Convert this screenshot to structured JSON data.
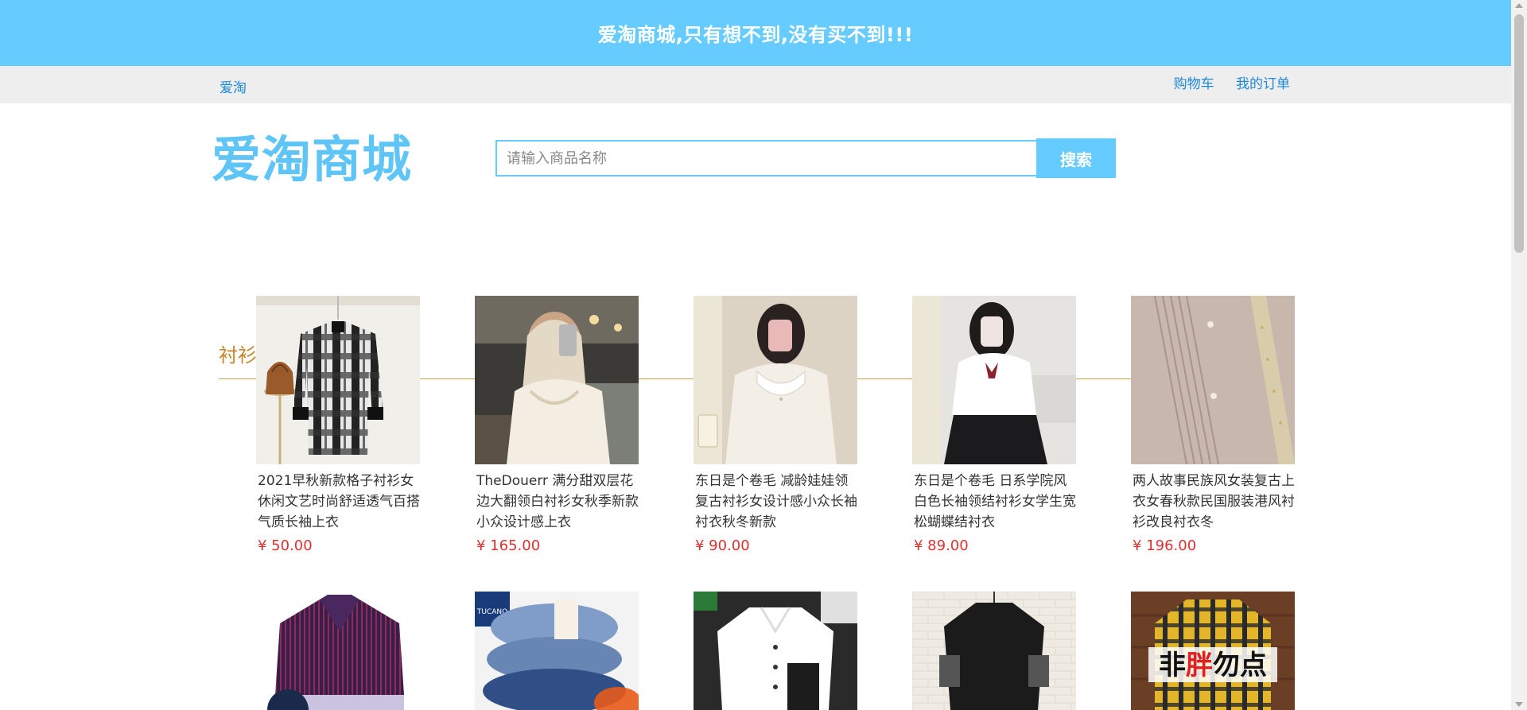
{
  "banner": {
    "text": "爱淘商城,只有想不到,没有买不到!!!"
  },
  "topnav": {
    "brand": "爱淘",
    "cart": "购物车",
    "orders": "我的订单"
  },
  "header": {
    "logo": "爱淘商城",
    "search_placeholder": "请输入商品名称",
    "search_button": "搜索"
  },
  "category": {
    "title": "衬衫"
  },
  "products": [
    {
      "title": "2021早秋新款格子衬衫女休闲文艺时尚舒适透气百搭气质长袖上衣",
      "price": "¥ 50.00"
    },
    {
      "title": "TheDouerr 满分甜双层花边大翻领白衬衫女秋季新款小众设计感上衣",
      "price": "¥ 165.00"
    },
    {
      "title": "东日是个卷毛 减龄娃娃领复古衬衫女设计感小众长袖衬衣秋冬新款",
      "price": "¥ 90.00"
    },
    {
      "title": "东日是个卷毛 日系学院风白色长袖领结衬衫女学生宽松蝴蝶结衬衣",
      "price": "¥ 89.00"
    },
    {
      "title": "两人故事民族风女装复古上衣女春秋款民国服装港风衬衫改良衬衣冬",
      "price": "¥ 196.00"
    }
  ],
  "row2": {
    "tucano_label": "TUCANO",
    "slogan_a": "非",
    "slogan_b": "胖",
    "slogan_c": "勿点"
  },
  "colors": {
    "accent": "#66ccff",
    "price": "#e03131",
    "category": "#c8862a"
  }
}
